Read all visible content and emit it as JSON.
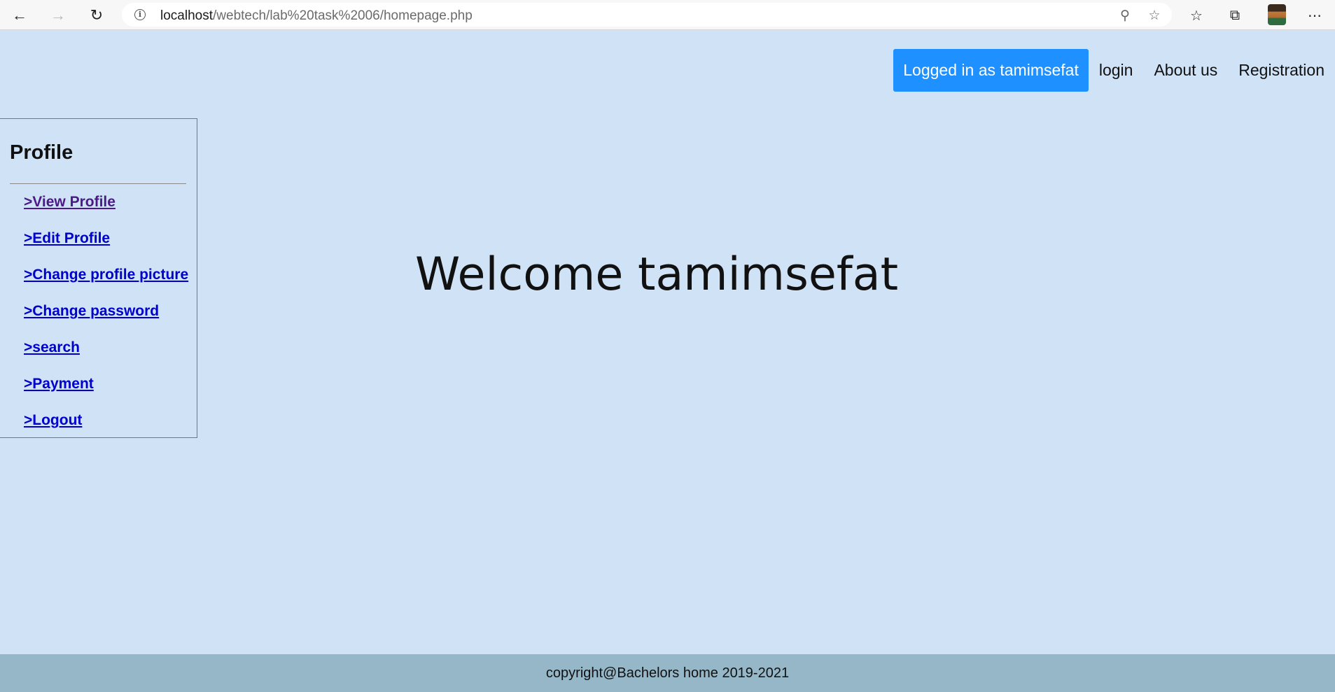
{
  "browser": {
    "url_host": "localhost",
    "url_path": "/webtech/lab%20task%2006/homepage.php"
  },
  "topnav": {
    "status_button": "Logged in as tamimsefat",
    "links": [
      "login",
      "About us",
      "Registration"
    ]
  },
  "sidebar": {
    "title": "Profile",
    "links": [
      ">View Profile",
      ">Edit Profile",
      ">Change profile picture",
      ">Change password",
      ">search",
      ">Payment",
      ">Logout"
    ]
  },
  "main": {
    "welcome": "Welcome tamimsefat"
  },
  "footer": {
    "text": "copyright@Bachelors home 2019-2021"
  },
  "colors": {
    "page_background": "#cfe2f6",
    "accent_button": "#1e90ff",
    "footer_background": "#95b7c8",
    "link": "#0000cc",
    "visited_link": "#4b1a86"
  }
}
